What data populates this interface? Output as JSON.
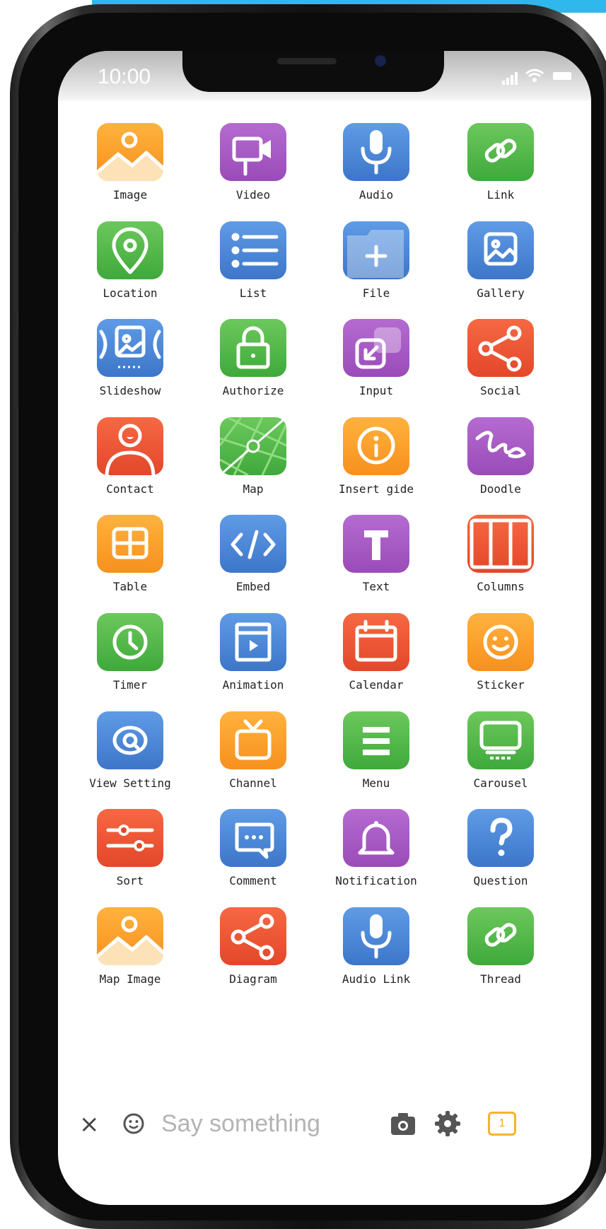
{
  "status": {
    "time": "10:00"
  },
  "grid": [
    {
      "label": "Image",
      "icon": "image-icon",
      "color": "orange"
    },
    {
      "label": "Video",
      "icon": "video-icon",
      "color": "purple"
    },
    {
      "label": "Audio",
      "icon": "microphone-icon",
      "color": "blue"
    },
    {
      "label": "Link",
      "icon": "link-icon",
      "color": "green"
    },
    {
      "label": "Location",
      "icon": "location-pin-icon",
      "color": "green"
    },
    {
      "label": "List",
      "icon": "list-icon",
      "color": "blue"
    },
    {
      "label": "File",
      "icon": "folder-add-icon",
      "color": "blue"
    },
    {
      "label": "Gallery",
      "icon": "gallery-icon",
      "color": "blue"
    },
    {
      "label": "Slideshow",
      "icon": "slideshow-icon",
      "color": "blue"
    },
    {
      "label": "Authorize",
      "icon": "lock-icon",
      "color": "green"
    },
    {
      "label": "Input",
      "icon": "input-icon",
      "color": "purple"
    },
    {
      "label": "Social",
      "icon": "share-icon",
      "color": "red"
    },
    {
      "label": "Contact",
      "icon": "contact-icon",
      "color": "red"
    },
    {
      "label": "Map",
      "icon": "map-icon",
      "color": "green"
    },
    {
      "label": "Insert gide",
      "icon": "info-icon",
      "color": "orange"
    },
    {
      "label": "Doodle",
      "icon": "doodle-icon",
      "color": "purple"
    },
    {
      "label": "Table",
      "icon": "table-icon",
      "color": "orange"
    },
    {
      "label": "Embed",
      "icon": "code-icon",
      "color": "blue"
    },
    {
      "label": "Text",
      "icon": "text-icon",
      "color": "purple"
    },
    {
      "label": "Columns",
      "icon": "columns-icon",
      "color": "red"
    },
    {
      "label": "Timer",
      "icon": "clock-icon",
      "color": "green"
    },
    {
      "label": "Animation",
      "icon": "animation-icon",
      "color": "blue"
    },
    {
      "label": "Calendar",
      "icon": "calendar-icon",
      "color": "red"
    },
    {
      "label": "Sticker",
      "icon": "smiley-icon",
      "color": "orange"
    },
    {
      "label": "View Setting",
      "icon": "eye-icon",
      "color": "blue"
    },
    {
      "label": "Channel",
      "icon": "tv-icon",
      "color": "orange"
    },
    {
      "label": "Menu",
      "icon": "menu-icon",
      "color": "green"
    },
    {
      "label": "Carousel",
      "icon": "carousel-icon",
      "color": "green"
    },
    {
      "label": "Sort",
      "icon": "sliders-icon",
      "color": "red"
    },
    {
      "label": "Comment",
      "icon": "comment-icon",
      "color": "blue"
    },
    {
      "label": "Notification",
      "icon": "bell-icon",
      "color": "purple"
    },
    {
      "label": "Question",
      "icon": "question-icon",
      "color": "blue"
    },
    {
      "label": "Map Image",
      "icon": "image-icon",
      "color": "orange"
    },
    {
      "label": "Diagram",
      "icon": "share-icon",
      "color": "red"
    },
    {
      "label": "Audio Link",
      "icon": "microphone-icon",
      "color": "blue"
    },
    {
      "label": "Thread",
      "icon": "link-icon",
      "color": "green"
    }
  ],
  "bottom_bar": {
    "close": "×",
    "placeholder": "Say something",
    "badge": "1"
  }
}
